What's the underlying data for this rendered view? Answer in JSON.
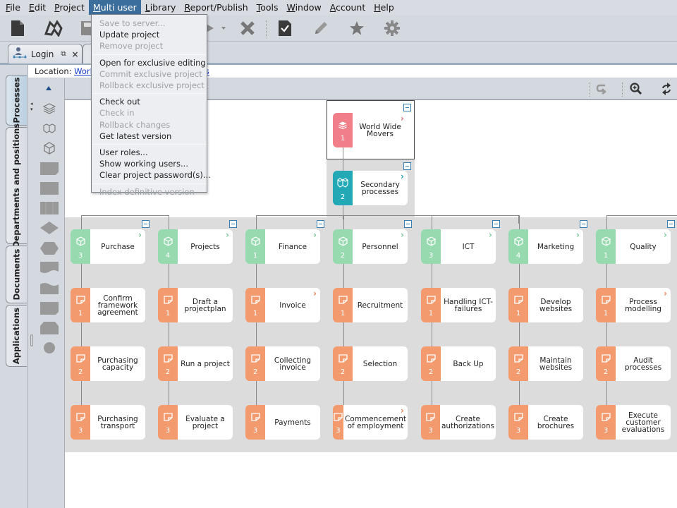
{
  "menubar": {
    "items": [
      {
        "label": "File",
        "u": "F"
      },
      {
        "label": "Edit",
        "u": "E"
      },
      {
        "label": "Project",
        "u": "P"
      },
      {
        "label": "Multi user",
        "u": "M",
        "active": true
      },
      {
        "label": "Library",
        "u": "L"
      },
      {
        "label": "Report/Publish",
        "u": "R"
      },
      {
        "label": "Tools",
        "u": "T"
      },
      {
        "label": "Window",
        "u": "W"
      },
      {
        "label": "Account",
        "u": "A"
      },
      {
        "label": "Help",
        "u": "H"
      }
    ]
  },
  "toolbar": {
    "icons": [
      "new-document-icon",
      "open-folder-icon",
      "save-disk-icon",
      "play-icon",
      "dropdown-arrow-icon",
      "delete-x-icon",
      "checked-document-icon",
      "pencil-icon",
      "star-icon",
      "gear-icon"
    ]
  },
  "tabs": {
    "doc_tab_label": "Login"
  },
  "side_tabs": [
    "Processes",
    "Departments and positions",
    "Documents",
    "Applications"
  ],
  "location": {
    "label": "Location:",
    "link1": "World",
    "link2": "rs"
  },
  "multi_user_menu": {
    "groups": [
      [
        {
          "label": "Save to server...",
          "enabled": false
        },
        {
          "label": "Update project",
          "enabled": true
        },
        {
          "label": "Remove project",
          "enabled": false
        }
      ],
      [
        {
          "label": "Open for exclusive editing",
          "enabled": true
        },
        {
          "label": "Commit exclusive project",
          "enabled": false
        },
        {
          "label": "Rollback exclusive project",
          "enabled": false
        }
      ],
      [
        {
          "label": "Check out",
          "enabled": true
        },
        {
          "label": "Check in",
          "enabled": false
        },
        {
          "label": "Rollback changes",
          "enabled": false
        },
        {
          "label": "Get latest version",
          "enabled": true
        }
      ],
      [
        {
          "label": "User roles...",
          "enabled": true
        },
        {
          "label": "Show working users...",
          "enabled": true
        },
        {
          "label": "Clear project password(s)...",
          "enabled": true
        }
      ],
      [
        {
          "label": "Index definitive version",
          "enabled": false
        }
      ]
    ]
  },
  "colors": {
    "root": "#f07f8a",
    "secondary": "#23a9b5",
    "group": "#98dab0",
    "process": "#f39a6e",
    "menu_active": "#3c6e9b"
  },
  "diagram": {
    "root": {
      "label": "World Wide Movers",
      "number": "1"
    },
    "secondary": {
      "label": "Secondary processes",
      "number": "2"
    },
    "columns": [
      {
        "group": {
          "label": "Purchase",
          "number": "3"
        },
        "processes": [
          {
            "label": "Confirm framework agreement",
            "number": "1"
          },
          {
            "label": "Purchasing capacity",
            "number": "2"
          },
          {
            "label": "Purchasing transport",
            "number": "3"
          }
        ]
      },
      {
        "group": {
          "label": "Projects",
          "number": "4"
        },
        "processes": [
          {
            "label": "Draft a projectplan",
            "number": "1"
          },
          {
            "label": "Run a project",
            "number": "2"
          },
          {
            "label": "Evaluate a project",
            "number": "3"
          }
        ]
      },
      {
        "group": {
          "label": "Finance",
          "number": "1"
        },
        "processes": [
          {
            "label": "Invoice",
            "number": "1",
            "chevron": true
          },
          {
            "label": "Collecting invoice",
            "number": "2"
          },
          {
            "label": "Payments",
            "number": "3"
          }
        ]
      },
      {
        "group": {
          "label": "Personnel",
          "number": "2"
        },
        "processes": [
          {
            "label": "Recruitment",
            "number": "1"
          },
          {
            "label": "Selection",
            "number": "2"
          },
          {
            "label": "Commencement of employment",
            "number": "3",
            "chevron": true
          }
        ]
      },
      {
        "group": {
          "label": "ICT",
          "number": "3"
        },
        "processes": [
          {
            "label": "Handling ICT-failures",
            "number": "1"
          },
          {
            "label": "Back Up",
            "number": "2"
          },
          {
            "label": "Create authorizations",
            "number": "3"
          }
        ]
      },
      {
        "group": {
          "label": "Marketing",
          "number": "4"
        },
        "processes": [
          {
            "label": "Develop websites",
            "number": "1"
          },
          {
            "label": "Maintain websites",
            "number": "2"
          },
          {
            "label": "Create brochures",
            "number": "3"
          }
        ]
      },
      {
        "group": {
          "label": "Quality",
          "number": "1"
        },
        "processes": [
          {
            "label": "Process modelling",
            "number": "1",
            "chevron": true
          },
          {
            "label": "Audit processes",
            "number": "2"
          },
          {
            "label": "Execute customer evaluations",
            "number": "3"
          }
        ]
      }
    ]
  }
}
